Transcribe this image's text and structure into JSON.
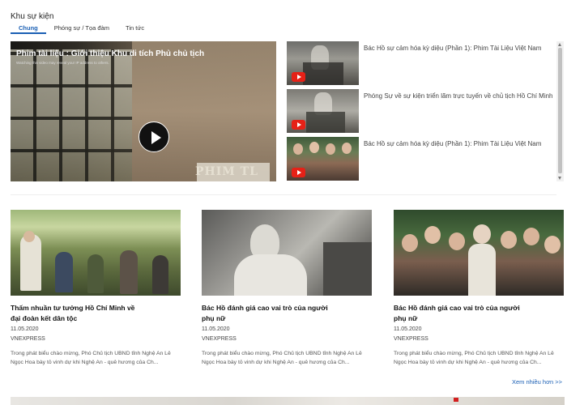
{
  "section": {
    "title": "Khu sự kiện"
  },
  "tabs": [
    {
      "label": "Chung",
      "active": true
    },
    {
      "label": "Phóng sự / Tọa đàm",
      "active": false
    },
    {
      "label": "Tin tức",
      "active": false
    }
  ],
  "video": {
    "title": "Phim tài liệu : Giới thiệu Khu di tích Phủ chủ tịch",
    "note": "Watching this video may reveal your IP address to others.",
    "overlay_text": "PHIM TL",
    "play_icon": "play-icon"
  },
  "playlist": [
    {
      "title": "Bác Hồ sự cảm hóa kỳ diệu (Phần 1): Phim Tài Liệu Việt Nam",
      "icon": "youtube-icon"
    },
    {
      "title": "Phóng Sự về sự kiện triển lãm trực tuyến về chủ tịch Hồ Chí Minh",
      "icon": "youtube-icon"
    },
    {
      "title": "Bác Hồ sự cảm hóa kỳ diệu (Phần 1): Phim Tài Liệu Việt Nam",
      "icon": "youtube-icon"
    }
  ],
  "cards": [
    {
      "title": "Thấm nhuần tư tưởng Hồ Chí Minh về đại đoàn kết dân tộc",
      "date": "11.05.2020",
      "source": "VNEXPRESS",
      "desc": "Trong phát biểu chào mừng, Phó Chủ tịch UBND tỉnh Nghệ An Lê Ngọc Hoa bày tỏ vinh dự khi Nghệ An - quê hương của Ch..."
    },
    {
      "title": "Bác Hồ đánh giá cao vai trò của người phụ nữ",
      "date": "11.05.2020",
      "source": "VNEXPRESS",
      "desc": "Trong phát biểu chào mừng, Phó Chủ tịch UBND tỉnh Nghệ An Lê Ngọc Hoa bày tỏ vinh dự khi Nghệ An - quê hương của Ch..."
    },
    {
      "title": "Bác Hồ đánh giá cao vai trò của người phụ nữ",
      "date": "11.05.2020",
      "source": "VNEXPRESS",
      "desc": "Trong phát biểu chào mừng, Phó Chủ tịch UBND tỉnh Nghệ An Lê Ngọc Hoa bày tỏ vinh dự khi Nghệ An - quê hương của Ch..."
    }
  ],
  "more": {
    "label": "Xem nhiều hơn >>"
  },
  "colors": {
    "accent": "#1a5fb4",
    "youtube_red": "#e62117"
  }
}
